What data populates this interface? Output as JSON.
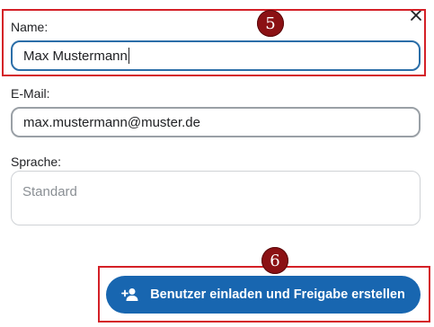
{
  "form": {
    "name_label": "Name:",
    "name_value": "Max Mustermann",
    "email_label": "E-Mail:",
    "email_value": "max.mustermann@muster.de",
    "language_label": "Sprache:",
    "language_placeholder": "Standard"
  },
  "action": {
    "submit_label": "Benutzer einladen und Freigabe erstellen"
  },
  "annotations": {
    "step5": "5",
    "step6": "6"
  },
  "colors": {
    "accent": "#1866b0",
    "highlight": "#d42027",
    "badge": "#8b1114",
    "focus_border": "#2b6ea8"
  },
  "icons": {
    "close": "close-icon",
    "add_user": "person-add-icon"
  }
}
